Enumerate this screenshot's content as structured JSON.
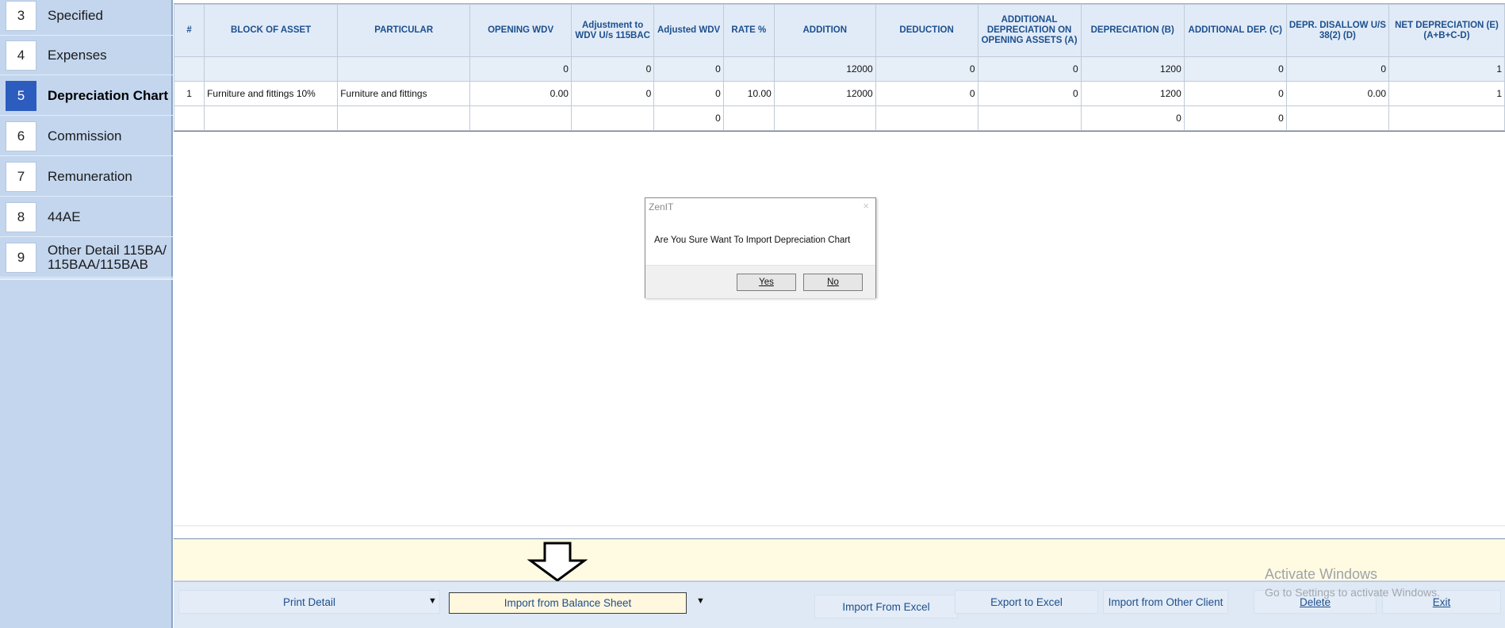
{
  "sidebar": {
    "items": [
      {
        "num": "3",
        "label": "Specified"
      },
      {
        "num": "4",
        "label": "Expenses"
      },
      {
        "num": "5",
        "label": "Depreciation Chart"
      },
      {
        "num": "6",
        "label": "Commission"
      },
      {
        "num": "7",
        "label": "Remuneration"
      },
      {
        "num": "8",
        "label": "44AE"
      },
      {
        "num": "9",
        "label": "Other Detail 115BA/",
        "label2": "115BAA/115BAB"
      }
    ],
    "active_index": 2
  },
  "table": {
    "headers": [
      "#",
      "BLOCK OF ASSET",
      "PARTICULAR",
      "OPENING WDV",
      "Adjustment to WDV U/s 115BAC",
      "Adjusted WDV",
      "RATE %",
      "ADDITION",
      "DEDUCTION",
      "ADDITIONAL DEPRECIATION ON OPENING ASSETS (A)",
      "DEPRECIATION (B)",
      "ADDITIONAL DEP. (C)",
      "DEPR. DISALLOW U/S 38(2) (D)",
      "NET DEPRECIATION (E)(A+B+C-D)"
    ],
    "summary_row": [
      "",
      "",
      "",
      "0",
      "0",
      "0",
      "",
      "12000",
      "0",
      "0",
      "1200",
      "0",
      "0",
      "1"
    ],
    "rows": [
      [
        "1",
        "Furniture and fittings 10%",
        "Furniture and fittings",
        "0.00",
        "0",
        "0",
        "10.00",
        "12000",
        "0",
        "0",
        "1200",
        "0",
        "0.00",
        "1"
      ],
      [
        "",
        "",
        "",
        "",
        "",
        "0",
        "",
        "",
        "",
        "",
        "0",
        "0",
        "",
        ""
      ]
    ]
  },
  "scrollbar": {
    "left_arrow": "<"
  },
  "dialog": {
    "title": "ZenIT",
    "close": "×",
    "message": "Are You Sure Want To Import Depreciation Chart",
    "yes_label": "Yes",
    "no_label": "No"
  },
  "footer": {
    "print_detail": "Print Detail",
    "import_balance_sheet": "Import from Balance Sheet",
    "import_excel": "Import From Excel",
    "export_excel": "Export to Excel",
    "import_other_client": "Import from Other Client",
    "delete": "Delete",
    "exit": "Exit",
    "dropdown_glyph": "▼"
  },
  "watermark": {
    "line1": "Activate Windows",
    "line2": "Go to Settings to activate Windows."
  },
  "colors": {
    "sidebar_bg": "#c3d6ee",
    "active_badge": "#2d5cbf",
    "header_text": "#1d4f8e",
    "notice_bg": "#fffbe2",
    "footer_bg": "#dfe9f5"
  }
}
